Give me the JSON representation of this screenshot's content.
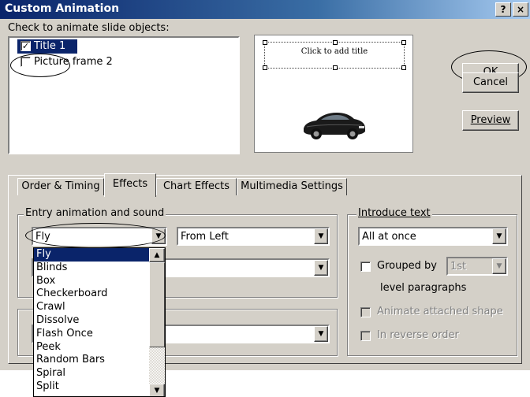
{
  "window": {
    "title": "Custom Animation",
    "help_label": "?",
    "close_label": "×"
  },
  "objects": {
    "label": "Check to animate slide objects:",
    "items": [
      {
        "label": "Title 1",
        "checked": true,
        "selected": true
      },
      {
        "label": "Picture frame 2",
        "checked": false,
        "selected": false
      }
    ]
  },
  "preview": {
    "placeholder_text": "Click to add title"
  },
  "buttons": {
    "ok": "OK",
    "cancel": "Cancel",
    "preview": "Preview"
  },
  "tabs": [
    {
      "label": "Order & Timing",
      "active": false
    },
    {
      "label": "Effects",
      "active": true
    },
    {
      "label": "Chart Effects",
      "active": false
    },
    {
      "label": "Multimedia Settings",
      "active": false
    }
  ],
  "entry": {
    "group_label": "Entry animation and sound",
    "effect_value": "Fly",
    "direction_value": "From Left",
    "effect_options": [
      "Fly",
      "Blinds",
      "Box",
      "Checkerboard",
      "Crawl",
      "Dissolve",
      "Flash Once",
      "Peek",
      "Random Bars",
      "Spiral",
      "Split"
    ]
  },
  "introduce": {
    "group_label": "Introduce text",
    "value": "All at once",
    "grouped_by_label": "Grouped by",
    "grouped_by_value": "1st",
    "level_label": "level paragraphs",
    "animate_shape_label": "Animate attached shape",
    "reverse_label": "In reverse order"
  },
  "colors": {
    "title_bar": "#0a246a",
    "selection": "#0a246a",
    "dialog_bg": "#d4d0c8"
  },
  "icons": {
    "dropdown_arrow": "▼",
    "scroll_up": "▲",
    "scroll_down": "▼",
    "check": "✓"
  }
}
